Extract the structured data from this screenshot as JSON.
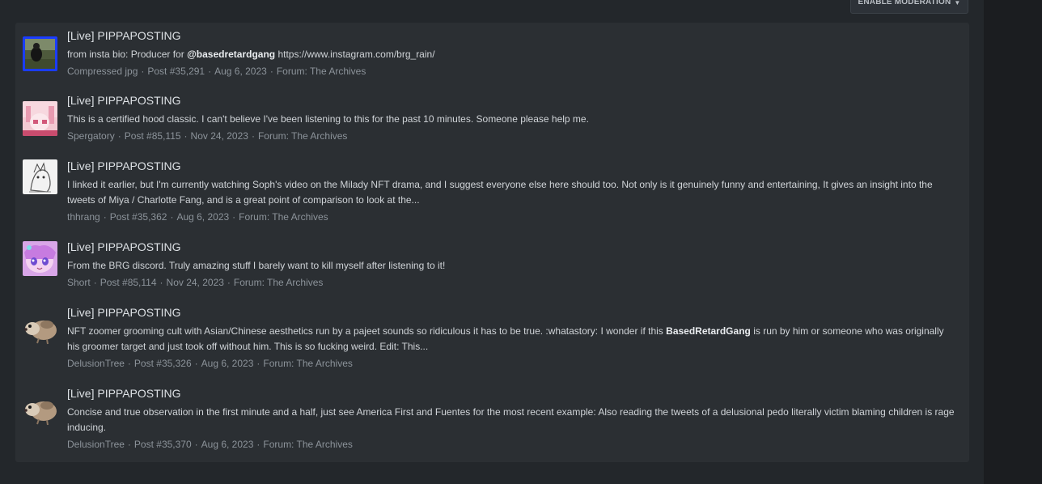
{
  "toolbar": {
    "moderation_label": "ENABLE MODERATION"
  },
  "results": [
    {
      "title": "[Live] PIPPAPOSTING",
      "snippet_before": "from insta bio: Producer for ",
      "snippet_bold": "@basedretardgang",
      "snippet_after": " https://www.instagram.com/brg_rain/",
      "author": "Compressed jpg",
      "post": "Post #35,291",
      "date": "Aug 6, 2023",
      "forum": "Forum: The Archives"
    },
    {
      "title": "[Live] PIPPAPOSTING",
      "snippet_before": "This is a certified hood classic. I can't believe I've been listening to this for the past 10 minutes. Someone please help me.",
      "snippet_bold": "",
      "snippet_after": "",
      "author": "Spergatory",
      "post": "Post #85,115",
      "date": "Nov 24, 2023",
      "forum": "Forum: The Archives"
    },
    {
      "title": "[Live] PIPPAPOSTING",
      "snippet_before": "I linked it earlier, but I'm currently watching Soph's video on the Milady NFT drama, and I suggest everyone else here should too. Not only is it genuinely funny and entertaining, It gives an insight into the tweets of Miya / Charlotte Fang, and is a great point of comparison to look at the...",
      "snippet_bold": "",
      "snippet_after": "",
      "author": "thhrang",
      "post": "Post #35,362",
      "date": "Aug 6, 2023",
      "forum": "Forum: The Archives"
    },
    {
      "title": "[Live] PIPPAPOSTING",
      "snippet_before": "From the BRG discord. Truly amazing stuff I barely want to kill myself after listening to it!",
      "snippet_bold": "",
      "snippet_after": "",
      "author": "Short",
      "post": "Post #85,114",
      "date": "Nov 24, 2023",
      "forum": "Forum: The Archives"
    },
    {
      "title": "[Live] PIPPAPOSTING",
      "snippet_before": "NFT zoomer grooming cult with Asian/Chinese aesthetics run by a pajeet sounds so ridiculous it has to be true. :whatastory: I wonder if this ",
      "snippet_bold": "BasedRetardGang",
      "snippet_after": " is run by him or someone who was originally his groomer target and just took off without him. This is so fucking weird. Edit: This...",
      "author": "DelusionTree",
      "post": "Post #35,326",
      "date": "Aug 6, 2023",
      "forum": "Forum: The Archives"
    },
    {
      "title": "[Live] PIPPAPOSTING",
      "snippet_before": "Concise and true observation in the first minute and a half, just see America First and Fuentes for the most recent example: Also reading the tweets of a delusional pedo literally victim blaming children is rage inducing.",
      "snippet_bold": "",
      "snippet_after": "",
      "author": "DelusionTree",
      "post": "Post #35,370",
      "date": "Aug 6, 2023",
      "forum": "Forum: The Archives"
    }
  ]
}
